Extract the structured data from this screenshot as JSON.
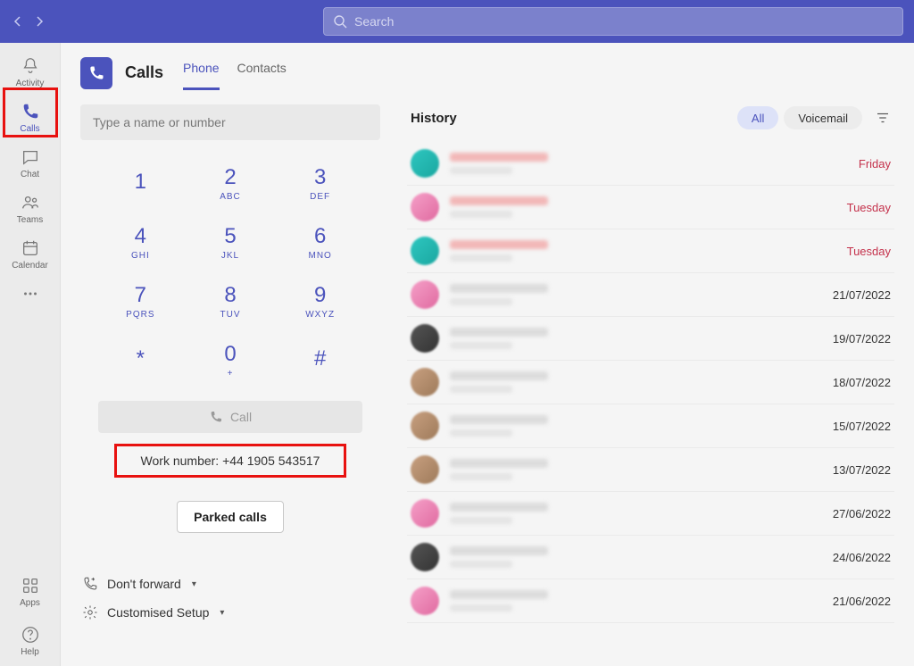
{
  "search": {
    "placeholder": "Search"
  },
  "rail": {
    "items": [
      {
        "id": "activity",
        "label": "Activity"
      },
      {
        "id": "calls",
        "label": "Calls"
      },
      {
        "id": "chat",
        "label": "Chat"
      },
      {
        "id": "teams",
        "label": "Teams"
      },
      {
        "id": "calendar",
        "label": "Calendar"
      }
    ],
    "more": "",
    "bottom": [
      {
        "id": "apps",
        "label": "Apps"
      },
      {
        "id": "help",
        "label": "Help"
      }
    ],
    "active": "calls"
  },
  "page": {
    "title": "Calls",
    "tabs": [
      {
        "id": "phone",
        "label": "Phone",
        "active": true
      },
      {
        "id": "contacts",
        "label": "Contacts",
        "active": false
      }
    ]
  },
  "dialer": {
    "placeholder": "Type a name or number",
    "keys": [
      {
        "digit": "1",
        "letters": ""
      },
      {
        "digit": "2",
        "letters": "ABC"
      },
      {
        "digit": "3",
        "letters": "DEF"
      },
      {
        "digit": "4",
        "letters": "GHI"
      },
      {
        "digit": "5",
        "letters": "JKL"
      },
      {
        "digit": "6",
        "letters": "MNO"
      },
      {
        "digit": "7",
        "letters": "PQRS"
      },
      {
        "digit": "8",
        "letters": "TUV"
      },
      {
        "digit": "9",
        "letters": "WXYZ"
      },
      {
        "digit": "*",
        "letters": ""
      },
      {
        "digit": "0",
        "letters": "+"
      },
      {
        "digit": "#",
        "letters": ""
      }
    ],
    "call_label": "Call",
    "work_number": "Work number: +44 1905 543517",
    "parked_label": "Parked calls",
    "forward_label": "Don't forward",
    "setup_label": "Customised Setup"
  },
  "history": {
    "title": "History",
    "filters": {
      "all": "All",
      "voicemail": "Voicemail"
    },
    "items": [
      {
        "date": "Friday",
        "missed": true,
        "avatar": "teal"
      },
      {
        "date": "Tuesday",
        "missed": true,
        "avatar": "pink"
      },
      {
        "date": "Tuesday",
        "missed": true,
        "avatar": "teal"
      },
      {
        "date": "21/07/2022",
        "missed": false,
        "avatar": "pink"
      },
      {
        "date": "19/07/2022",
        "missed": false,
        "avatar": "dark"
      },
      {
        "date": "18/07/2022",
        "missed": false,
        "avatar": "tan"
      },
      {
        "date": "15/07/2022",
        "missed": false,
        "avatar": "tan"
      },
      {
        "date": "13/07/2022",
        "missed": false,
        "avatar": "tan"
      },
      {
        "date": "27/06/2022",
        "missed": false,
        "avatar": "pink"
      },
      {
        "date": "24/06/2022",
        "missed": false,
        "avatar": "dark"
      },
      {
        "date": "21/06/2022",
        "missed": false,
        "avatar": "pink"
      }
    ]
  }
}
